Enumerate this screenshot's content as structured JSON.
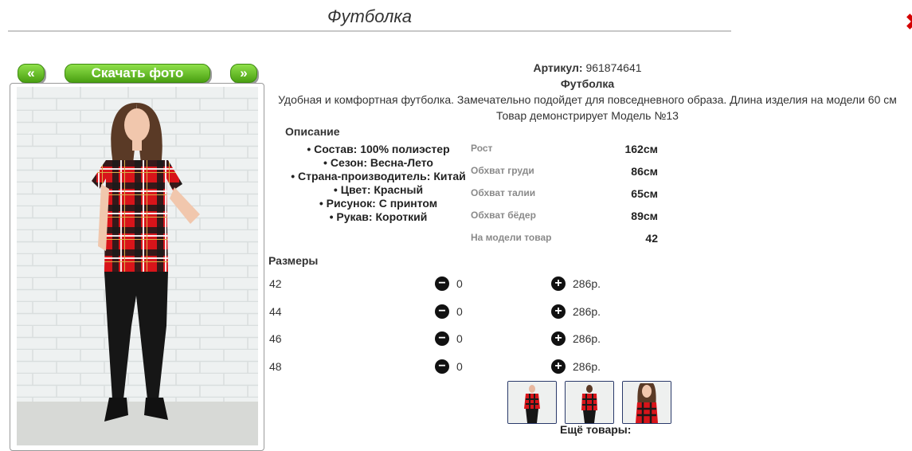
{
  "page": {
    "title": "Футболка"
  },
  "nav": {
    "prev_label": "«",
    "download_label": "Скачать фото",
    "next_label": "»"
  },
  "product": {
    "article_label": "Артикул:",
    "article_value": "961874641",
    "name": "Футболка",
    "summary": "Удобная и комфортная футболка. Замечательно подойдет для повседневного образа. Длина изделия на модели 60 см",
    "model_note": "Товар демонстрирует Модель №13"
  },
  "description": {
    "title": "Описание",
    "items": [
      "Состав: 100% полиэстер",
      "Сезон: Весна-Лето",
      "Страна-производитель: Китай",
      "Цвет: Красный",
      "Рисунок: С принтом",
      "Рукав: Короткий"
    ]
  },
  "measurements": [
    {
      "label": "Рост",
      "value": "162см"
    },
    {
      "label": "Обхват груди",
      "value": "86см"
    },
    {
      "label": "Обхват талии",
      "value": "65см"
    },
    {
      "label": "Обхват бёдер",
      "value": "89см"
    },
    {
      "label": "На модели товар",
      "value": "42"
    }
  ],
  "sizes": {
    "title": "Размеры",
    "rows": [
      {
        "size": "42",
        "qty": "0",
        "price": "286р."
      },
      {
        "size": "44",
        "qty": "0",
        "price": "286р."
      },
      {
        "size": "46",
        "qty": "0",
        "price": "286р."
      },
      {
        "size": "48",
        "qty": "0",
        "price": "286р."
      }
    ]
  },
  "more_label": "Ещё товары:",
  "colors": {
    "button_green": "#5cb81c",
    "shirt_red": "#d8141a",
    "close_red": "#d40000"
  }
}
